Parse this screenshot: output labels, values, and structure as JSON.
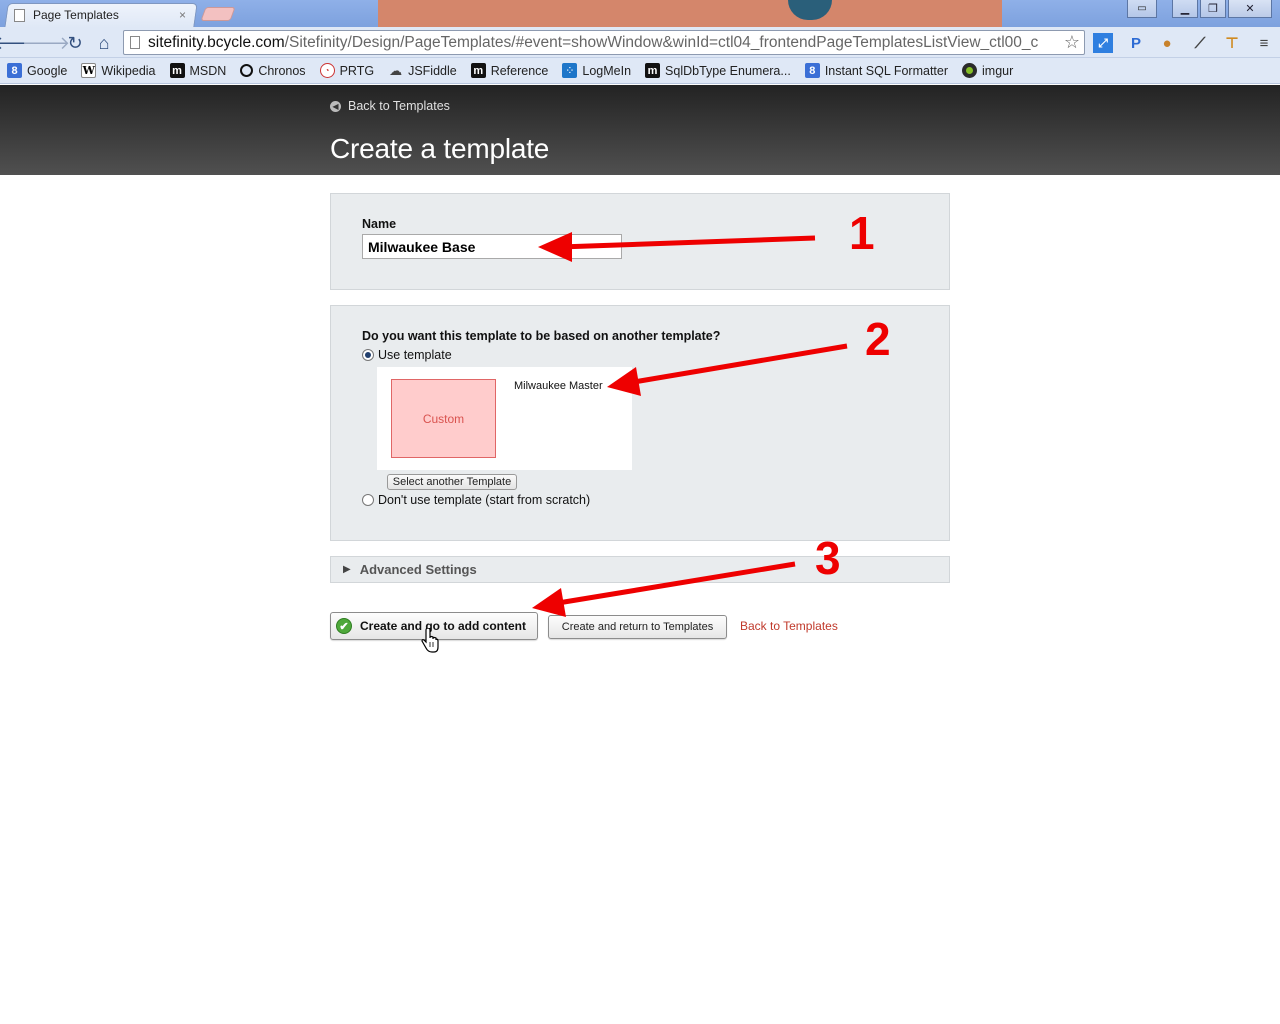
{
  "browser": {
    "tab_title": "Page Templates",
    "tab_close": "×",
    "url_host": "sitefinity.bcycle.com",
    "url_path": "/Sitefinity/Design/PageTemplates/#event=showWindow&winId=ctl04_frontendPageTemplatesListView_ctl00_c",
    "bookmarks": [
      {
        "label": "Google",
        "icon": "google-icon"
      },
      {
        "label": "Wikipedia",
        "icon": "wikipedia-icon"
      },
      {
        "label": "MSDN",
        "icon": "msdn-icon"
      },
      {
        "label": "Chronos",
        "icon": "chronos-icon"
      },
      {
        "label": "PRTG",
        "icon": "prtg-icon"
      },
      {
        "label": "JSFiddle",
        "icon": "jsfiddle-icon"
      },
      {
        "label": "Reference",
        "icon": "reference-icon"
      },
      {
        "label": "LogMeIn",
        "icon": "logmein-icon"
      },
      {
        "label": "SqlDbType Enumera...",
        "icon": "msdn-icon"
      },
      {
        "label": "Instant SQL Formatter",
        "icon": "google-icon"
      },
      {
        "label": "imgur",
        "icon": "imgur-icon"
      }
    ]
  },
  "header": {
    "back_label": "Back to Templates",
    "title": "Create a template"
  },
  "form": {
    "name_label": "Name",
    "name_value": "Milwaukee Base",
    "question": "Do you want this template to be based on another template?",
    "use_template_label": "Use template",
    "thumbnail_label": "Custom",
    "selected_template": "Milwaukee Master",
    "select_another_label": "Select another Template",
    "no_template_label": "Don't use template (start from scratch)",
    "advanced_label": "Advanced Settings"
  },
  "actions": {
    "primary_label": "Create and go to add content",
    "secondary_label": "Create and return to Templates",
    "back_link_label": "Back to Templates"
  },
  "annotations": {
    "color": "#ee0000",
    "steps": [
      "1",
      "2",
      "3"
    ]
  }
}
